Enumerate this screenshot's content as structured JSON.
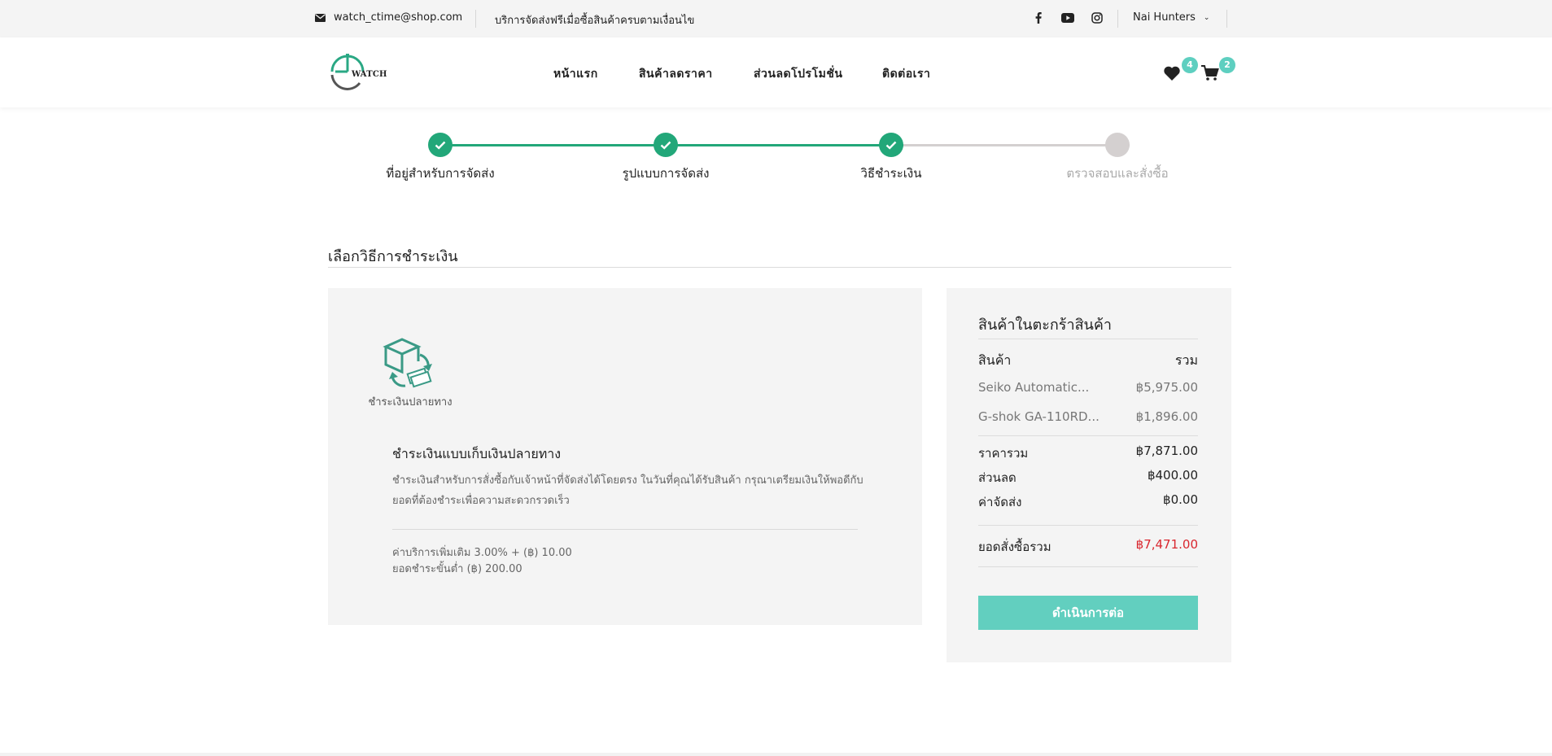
{
  "topbar": {
    "email": "watch_ctime@shop.com",
    "promo": "บริการจัดส่งฟรีเมื่อซื้อสินค้าครบตามเงื่อนไข",
    "social": [
      "facebook-icon",
      "youtube-icon",
      "instagram-icon"
    ],
    "user_name": "Nai Hunters"
  },
  "header": {
    "logo_text": "WATCH",
    "nav": [
      "หน้าแรก",
      "สินค้าลดราคา",
      "ส่วนลดโปรโมชั่น",
      "ติดต่อเรา"
    ],
    "wishlist_count": "4",
    "cart_count": "2"
  },
  "stepper": {
    "steps": [
      {
        "label": "ที่อยู่สำหรับการจัดส่ง",
        "status": "done"
      },
      {
        "label": "รูปแบบการจัดส่ง",
        "status": "done"
      },
      {
        "label": "วิธีชำระเงิน",
        "status": "done"
      },
      {
        "label": "ตรวจสอบและสั่งซื้อ",
        "status": "pending"
      }
    ]
  },
  "payment": {
    "section_title": "เลือกวิธีการชำระเงิน",
    "option_label": "ชำระเงินปลายทาง",
    "title": "ชำระเงินแบบเก็บเงินปลายทาง",
    "description": "ชำระเงินสำหรับการสั่งซื้อกับเจ้าหน้าที่จัดส่งได้โดยตรง ในวันที่คุณได้รับสินค้า กรุณาเตรียมเงินให้พอดีกับยอดที่ต้องชำระเพื่อความสะดวกรวดเร็ว",
    "fee_note": "ค่าบริการเพิ่มเติม 3.00% + (฿) 10.00",
    "min_note": "ยอดชำระขั้นต่ำ (฿) 200.00"
  },
  "summary": {
    "title": "สินค้าในตะกร้าสินค้า",
    "col_product": "สินค้า",
    "col_total": "รวม",
    "items": [
      {
        "name": "Seiko Automatic...",
        "price": "฿5,975.00"
      },
      {
        "name": "G-shok GA-110RD...",
        "price": "฿1,896.00"
      }
    ],
    "subtotal_label": "ราคารวม",
    "subtotal": "฿7,871.00",
    "discount_label": "ส่วนลด",
    "discount": "฿400.00",
    "shipping_label": "ค่าจัดส่ง",
    "shipping": "฿0.00",
    "grand_total_label": "ยอดสั่งซื้อรวม",
    "grand_total": "฿7,471.00",
    "proceed_label": "ดำเนินการต่อ"
  },
  "colors": {
    "accent": "#22a779",
    "button": "#62cfbf",
    "badge": "#5ecfc0",
    "total_red": "#d9262e"
  }
}
